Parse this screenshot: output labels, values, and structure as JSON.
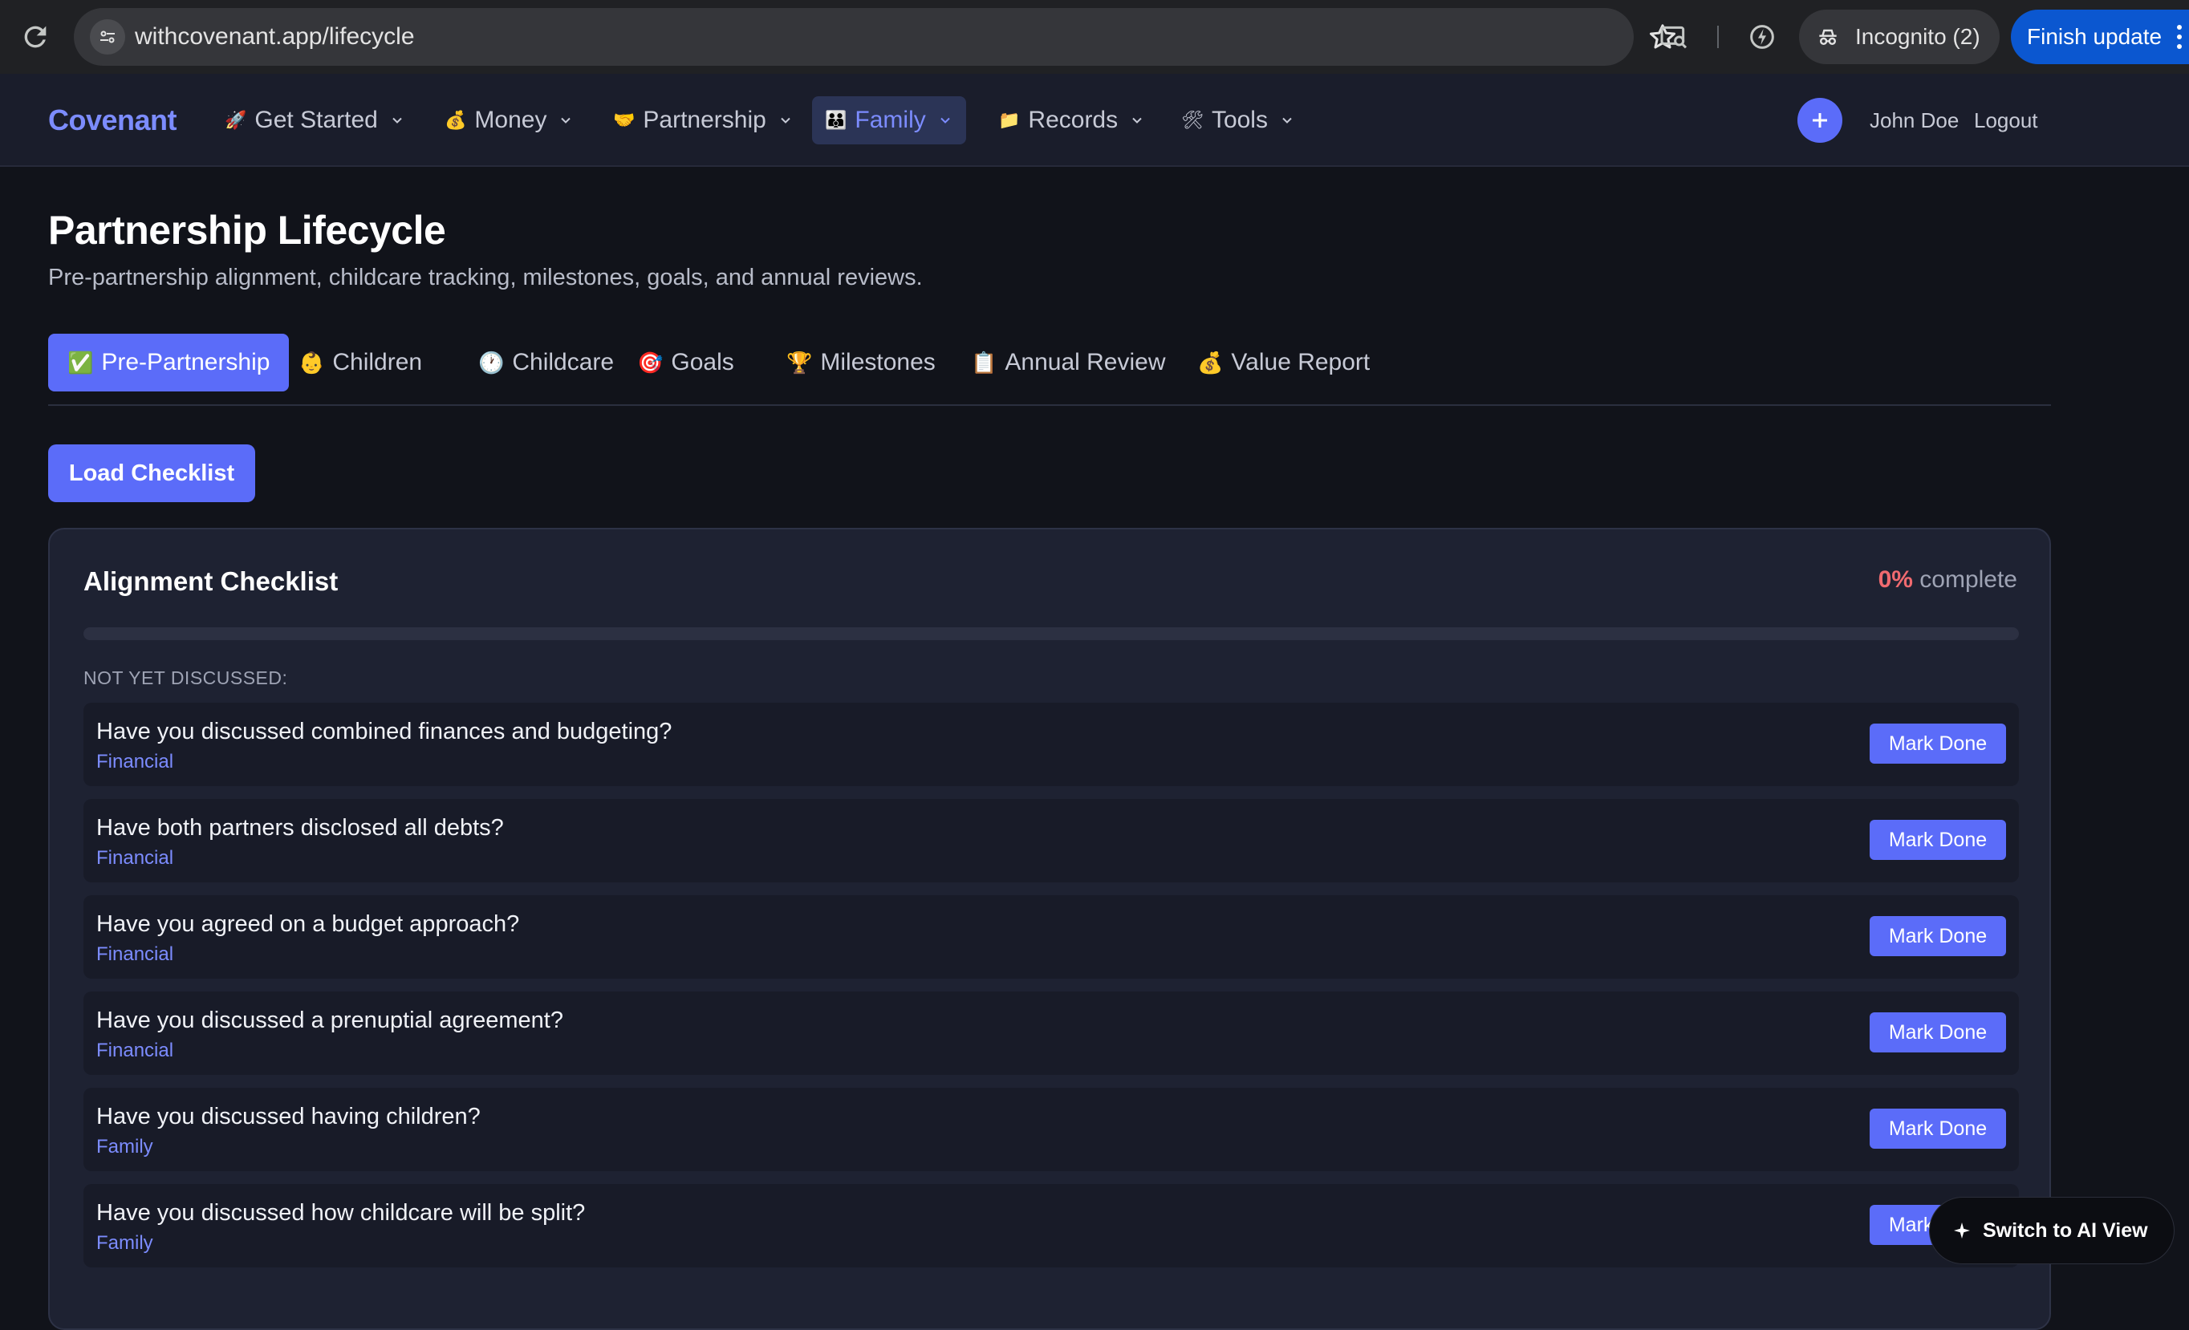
{
  "browser": {
    "url": "withcovenant.app/lifecycle",
    "incognito_label": "Incognito (2)",
    "update_label": "Finish update"
  },
  "nav": {
    "brand": "Covenant",
    "items": [
      {
        "icon": "🚀",
        "label": "Get Started"
      },
      {
        "icon": "💰",
        "label": "Money"
      },
      {
        "icon": "🤝",
        "label": "Partnership"
      },
      {
        "icon": "👪",
        "label": "Family",
        "active": true
      },
      {
        "icon": "📁",
        "label": "Records"
      },
      {
        "icon": "🛠",
        "label": "Tools"
      }
    ],
    "user_name": "John Doe",
    "logout_label": "Logout"
  },
  "page": {
    "title": "Partnership Lifecycle",
    "subtitle": "Pre-partnership alignment, childcare tracking, milestones, goals, and annual reviews."
  },
  "tabs": [
    {
      "icon": "✅",
      "label": "Pre-Partnership",
      "active": true
    },
    {
      "icon": "👶",
      "label": "Children"
    },
    {
      "icon": "🕐",
      "label": "Childcare"
    },
    {
      "icon": "🎯",
      "label": "Goals"
    },
    {
      "icon": "🏆",
      "label": "Milestones"
    },
    {
      "icon": "📋",
      "label": "Annual Review"
    },
    {
      "icon": "💰",
      "label": "Value Report"
    }
  ],
  "load_button": "Load Checklist",
  "checklist": {
    "title": "Alignment Checklist",
    "percent": "0%",
    "percent_label": "complete",
    "progress_fraction": 0,
    "section_label": "NOT YET DISCUSSED:",
    "mark_label": "Mark Done",
    "items": [
      {
        "question": "Have you discussed combined finances and budgeting?",
        "category": "Financial"
      },
      {
        "question": "Have both partners disclosed all debts?",
        "category": "Financial"
      },
      {
        "question": "Have you agreed on a budget approach?",
        "category": "Financial"
      },
      {
        "question": "Have you discussed a prenuptial agreement?",
        "category": "Financial"
      },
      {
        "question": "Have you discussed having children?",
        "category": "Family"
      },
      {
        "question": "Have you discussed how childcare will be split?",
        "category": "Family"
      }
    ]
  },
  "ai_switch_label": "Switch to AI View",
  "colors": {
    "accent": "#5b6cf9",
    "brand": "#7c8cff",
    "percent_red": "#f06a6f",
    "background": "#11131a",
    "card": "#1e2232"
  }
}
